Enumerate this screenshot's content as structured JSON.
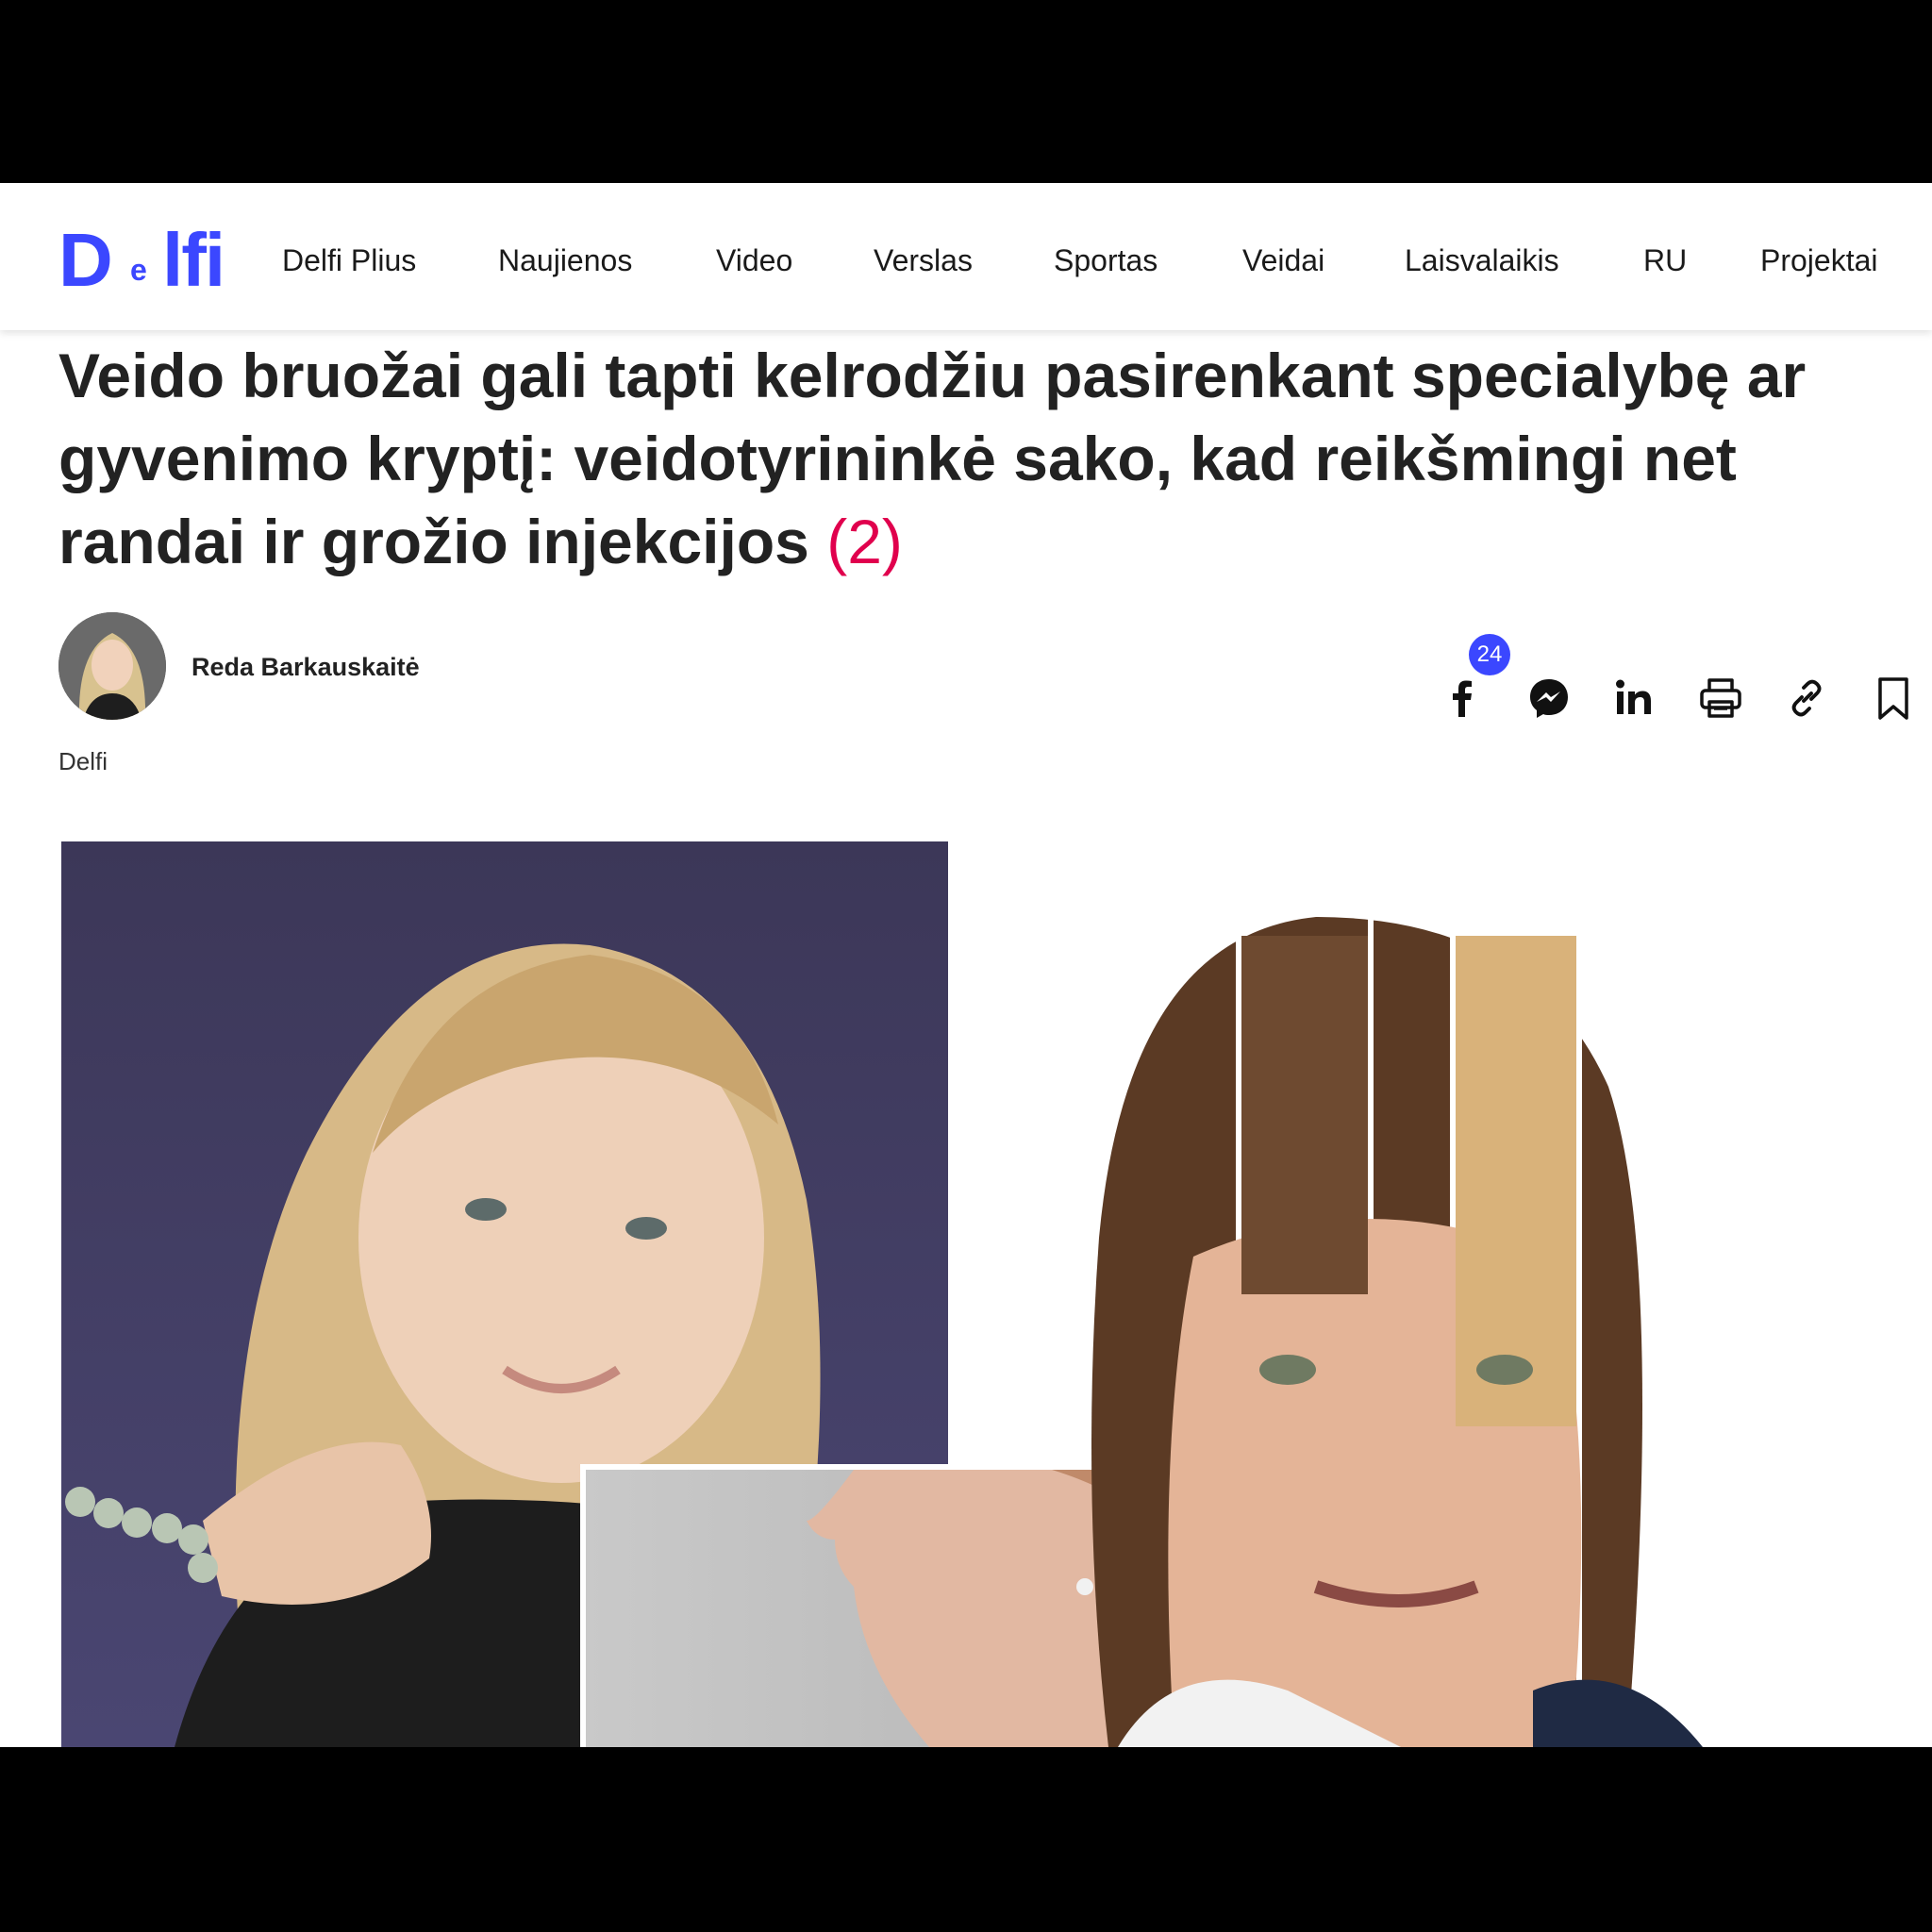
{
  "header": {
    "logo": {
      "d": "D",
      "e": "e",
      "lfi": "lfi"
    },
    "nav": [
      "Delfi Plius",
      "Naujienos",
      "Video",
      "Verslas",
      "Sportas",
      "Veidai",
      "Laisvalaikis",
      "RU",
      "Projektai"
    ]
  },
  "article": {
    "title": "Veido bruožai gali tapti kelrodžiu pasirenkant specialybę ar gyvenimo kryptį: veidotyrininkė sako, kad reikšmingi net randai ir grožio injekcijos",
    "comments": "(2)",
    "author": "Reda Barkauskaitė",
    "source": "Delfi"
  },
  "share": {
    "facebook_count": "24",
    "icons": [
      "facebook-icon",
      "messenger-icon",
      "linkedin-icon",
      "print-icon",
      "link-icon",
      "bookmark-icon"
    ]
  },
  "colors": {
    "brand": "#3b47ff",
    "comments": "#e0004d",
    "text": "#222222"
  }
}
